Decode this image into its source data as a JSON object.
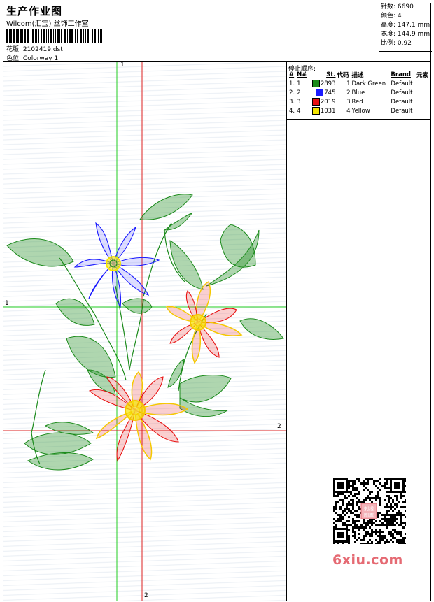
{
  "header": {
    "title": "生产作业图",
    "company": "Wilcom(汇宝) 丝饰工作室",
    "design_label": "花版:",
    "design_value": "2102419.dst",
    "colorway_label": "色位:",
    "colorway_value": "Colorway 1"
  },
  "stats": [
    {
      "label": "针数:",
      "value": "6690"
    },
    {
      "label": "颜色:",
      "value": "4"
    },
    {
      "label": "高度:",
      "value": "147.1 mm"
    },
    {
      "label": "宽度:",
      "value": "144.9 mm"
    },
    {
      "label": "比例:",
      "value": "0.92"
    }
  ],
  "stop_sequence": {
    "title": "停止顺序:",
    "columns": [
      "#",
      "N#",
      "St.",
      "代码",
      "描述",
      "Brand",
      "元素"
    ],
    "rows": [
      {
        "idx": "1.",
        "n": "1",
        "swatch": "#1a8a1a",
        "st": "2893",
        "code": "1",
        "desc": "Dark Green",
        "brand": "Default",
        "element": ""
      },
      {
        "idx": "2.",
        "n": "2",
        "swatch": "#1a1aff",
        "st": "745",
        "code": "2",
        "desc": "Blue",
        "brand": "Default",
        "element": ""
      },
      {
        "idx": "3.",
        "n": "3",
        "swatch": "#e81010",
        "st": "2019",
        "code": "3",
        "desc": "Red",
        "brand": "Default",
        "element": ""
      },
      {
        "idx": "4.",
        "n": "4",
        "swatch": "#f5e600",
        "st": "1031",
        "code": "4",
        "desc": "Yellow",
        "brand": "Default",
        "element": ""
      }
    ]
  },
  "guides": {
    "green_top": "1",
    "green_left": "1",
    "red_right": "2",
    "red_bottom": "2"
  },
  "colors": {
    "green": "#1a8a1a",
    "blue": "#1a1aff",
    "red": "#e81010",
    "yellow": "#f5e600",
    "guide_green": "#22cc22",
    "guide_red": "#dd2222",
    "watermark": "#e56a73"
  },
  "watermark": "6xiu.com",
  "qr_badge": "刺绣\n图库"
}
